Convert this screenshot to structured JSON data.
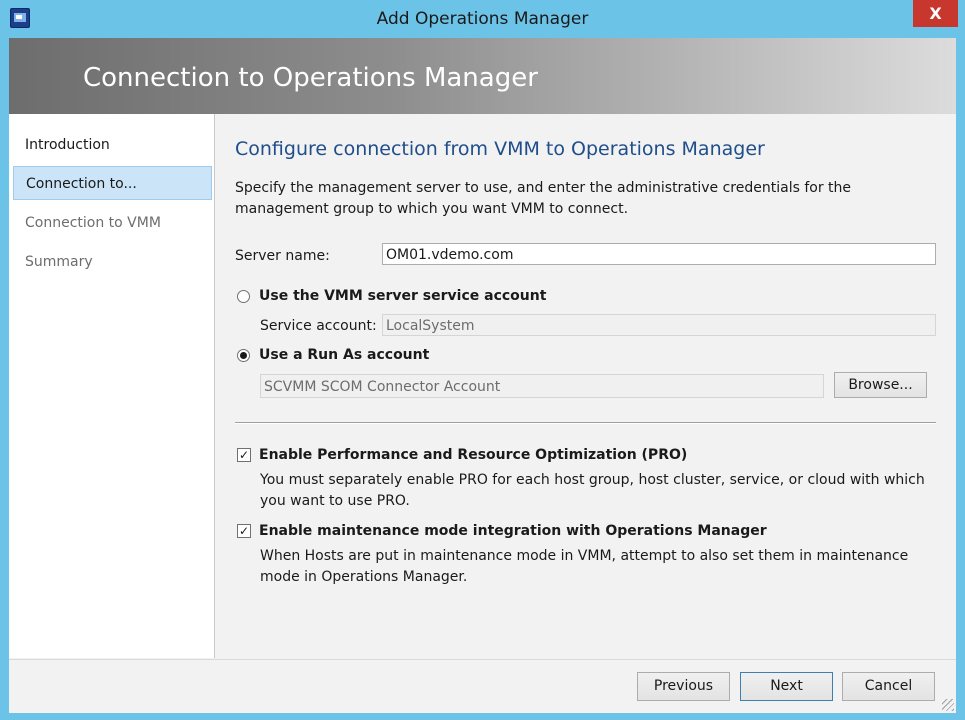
{
  "window": {
    "title": "Add Operations Manager",
    "close_glyph": "X"
  },
  "header": {
    "title": "Connection to Operations Manager"
  },
  "nav": {
    "items": [
      {
        "label": "Introduction"
      },
      {
        "label": "Connection to..."
      },
      {
        "label": "Connection to VMM"
      },
      {
        "label": "Summary"
      }
    ]
  },
  "main": {
    "title": "Configure connection from VMM to Operations Manager",
    "description": "Specify the management server to use, and enter the administrative credentials for the management group to which you want VMM to connect.",
    "server_name_label": "Server name:",
    "server_name_value": "OM01.vdemo.com",
    "option_service_account": "Use the VMM server service account",
    "service_account_label": "Service account:",
    "service_account_value": "LocalSystem",
    "option_run_as": "Use a Run As account",
    "run_as_value": "SCVMM SCOM Connector Account",
    "browse_label": "Browse...",
    "pro_label": "Enable Performance and Resource Optimization (PRO)",
    "pro_desc": "You must separately enable PRO for each host group, host cluster, service, or cloud with which you want to use PRO.",
    "maint_label": "Enable maintenance mode integration with Operations Manager",
    "maint_desc": "When Hosts are put in maintenance mode in VMM, attempt to also set them in maintenance mode in Operations Manager."
  },
  "footer": {
    "previous": "Previous",
    "next": "Next",
    "cancel": "Cancel"
  },
  "colors": {
    "frame": "#6cc3e8",
    "close": "#c7372d",
    "title_blue": "#1f4e8a",
    "selected_nav": "#cce4f7"
  },
  "icons": [
    "app-icon",
    "close-icon",
    "resize-grip-icon"
  ]
}
